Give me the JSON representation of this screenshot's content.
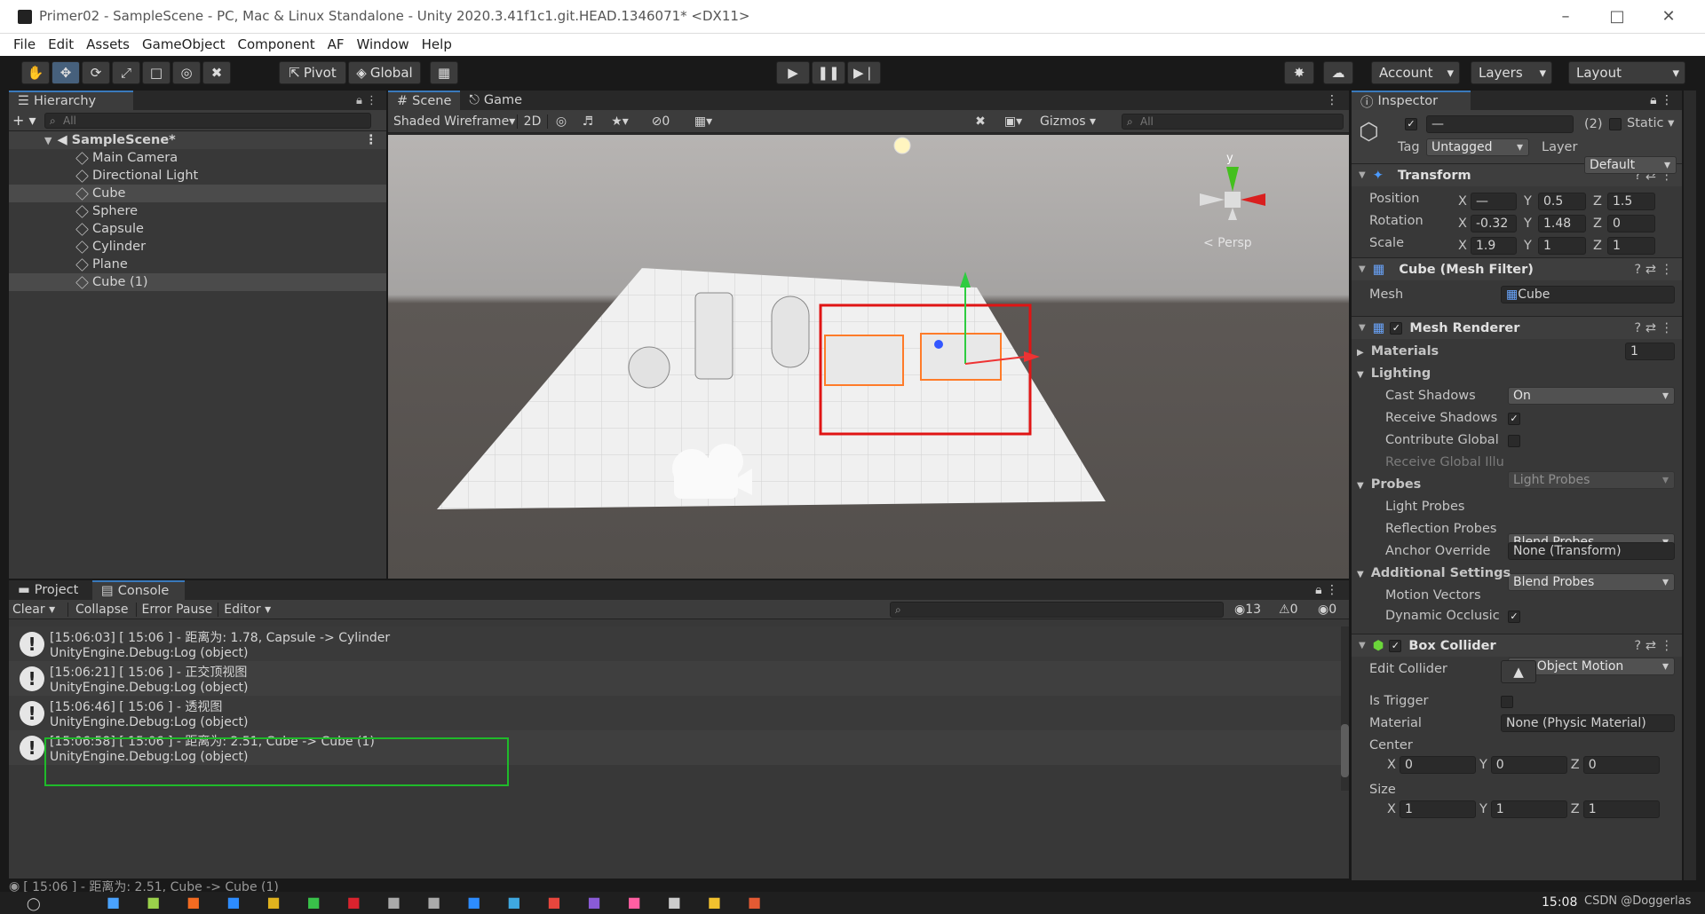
{
  "window": {
    "title": "Primer02 - SampleScene - PC, Mac & Linux Standalone - Unity 2020.3.41f1c1.git.HEAD.1346071* <DX11>"
  },
  "menu": [
    "File",
    "Edit",
    "Assets",
    "GameObject",
    "Component",
    "AF",
    "Window",
    "Help"
  ],
  "toolbar": {
    "pivot": "Pivot",
    "global": "Global",
    "account": "Account",
    "layers": "Layers",
    "layout": "Layout"
  },
  "hierarchy": {
    "tab": "Hierarchy",
    "search_placeholder": "All",
    "scene": "SampleScene*",
    "items": [
      "Main Camera",
      "Directional Light",
      "Cube",
      "Sphere",
      "Capsule",
      "Cylinder",
      "Plane",
      "Cube (1)"
    ]
  },
  "scene": {
    "tab_scene": "Scene",
    "tab_game": "Game",
    "shading": "Shaded Wireframe",
    "mode2d": "2D",
    "hidden_count": "0",
    "gizmos": "Gizmos",
    "search_placeholder": "All",
    "persp": "< Persp",
    "axis_y": "y"
  },
  "console": {
    "tab_project": "Project",
    "tab_console": "Console",
    "clear": "Clear",
    "collapse": "Collapse",
    "error_pause": "Error Pause",
    "editor": "Editor",
    "log_count": "13",
    "warn_count": "0",
    "err_count": "0",
    "entries": [
      {
        "line1": "[15:06:03] [ 15:06 ] - 距离为: 1.78, Capsule -> Cylinder",
        "line2": "UnityEngine.Debug:Log (object)"
      },
      {
        "line1": "[15:06:21] [ 15:06 ] - 正交顶视图",
        "line2": "UnityEngine.Debug:Log (object)"
      },
      {
        "line1": "[15:06:46] [ 15:06 ] - 透视图",
        "line2": "UnityEngine.Debug:Log (object)"
      },
      {
        "line1": "[15:06:58] [ 15:06 ] - 距离为: 2.51, Cube -> Cube (1)",
        "line2": "UnityEngine.Debug:Log (object)"
      }
    ],
    "status": "[ 15:06 ] - 距离为: 2.51, Cube -> Cube (1)"
  },
  "inspector": {
    "tab": "Inspector",
    "name_value": "—",
    "multi": "(2)",
    "static": "Static",
    "tag_label": "Tag",
    "tag": "Untagged",
    "layer_label": "Layer",
    "layer": "Default",
    "transform": {
      "title": "Transform",
      "position": {
        "label": "Position",
        "x": "—",
        "y": "0.5",
        "z": "1.5"
      },
      "rotation": {
        "label": "Rotation",
        "x": "-0.32",
        "y": "1.48",
        "z": "0"
      },
      "scale": {
        "label": "Scale",
        "x": "1.9",
        "y": "1",
        "z": "1"
      }
    },
    "mesh_filter": {
      "title": "Cube (Mesh Filter)",
      "mesh_label": "Mesh",
      "mesh": "Cube"
    },
    "mesh_renderer": {
      "title": "Mesh Renderer",
      "materials": "Materials",
      "materials_count": "1",
      "lighting": "Lighting",
      "cast_shadows": "Cast Shadows",
      "cast_shadows_val": "On",
      "receive_shadows": "Receive Shadows",
      "contribute_global": "Contribute Global",
      "receive_global": "Receive Global Illu",
      "receive_global_val": "Light Probes",
      "probes": "Probes",
      "light_probes": "Light Probes",
      "light_probes_val": "Blend Probes",
      "reflection_probes": "Reflection Probes",
      "reflection_probes_val": "Blend Probes",
      "anchor_override": "Anchor Override",
      "anchor_override_val": "None (Transform)",
      "additional": "Additional Settings",
      "motion_vectors": "Motion Vectors",
      "motion_vectors_val": "Per Object Motion",
      "dynamic_occlusion": "Dynamic Occlusic"
    },
    "box_collider": {
      "title": "Box Collider",
      "edit_collider": "Edit Collider",
      "is_trigger": "Is Trigger",
      "material": "Material",
      "material_val": "None (Physic Material)",
      "center": "Center",
      "cx": "0",
      "cy": "0",
      "cz": "0",
      "size": "Size",
      "sx": "1",
      "sy": "1",
      "sz": "1"
    }
  },
  "taskbar": {
    "time": "15:08",
    "watermark": "CSDN @Doggerlas"
  }
}
